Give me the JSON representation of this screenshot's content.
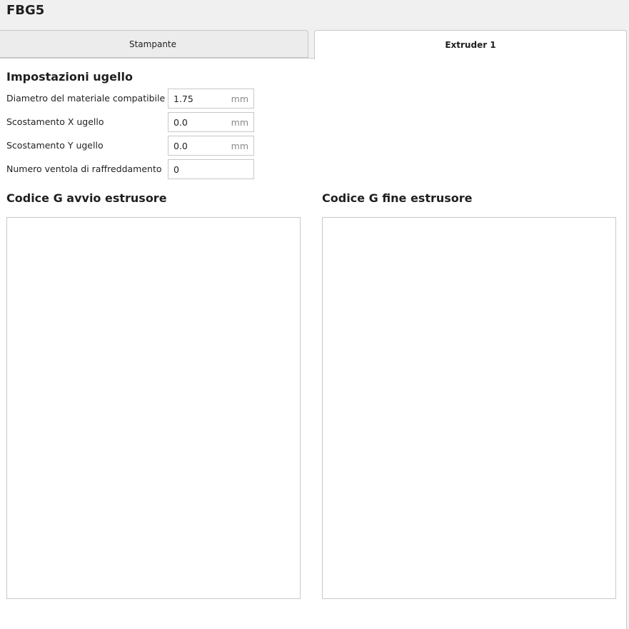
{
  "header": {
    "title": "FBG5"
  },
  "tabs": [
    {
      "label": "Stampante",
      "active": false
    },
    {
      "label": "Extruder 1",
      "active": true
    }
  ],
  "nozzle": {
    "heading": "Impostazioni ugello",
    "fields": [
      {
        "label": "Diametro del materiale compatibile",
        "value": "1.75",
        "unit": "mm"
      },
      {
        "label": "Scostamento X ugello",
        "value": "0.0",
        "unit": "mm"
      },
      {
        "label": "Scostamento Y ugello",
        "value": "0.0",
        "unit": "mm"
      },
      {
        "label": "Numero ventola di raffreddamento",
        "value": "0"
      }
    ]
  },
  "gcode": {
    "start_heading": "Codice G avvio estrusore",
    "start_value": "",
    "end_heading": "Codice G fine estrusore",
    "end_value": ""
  }
}
